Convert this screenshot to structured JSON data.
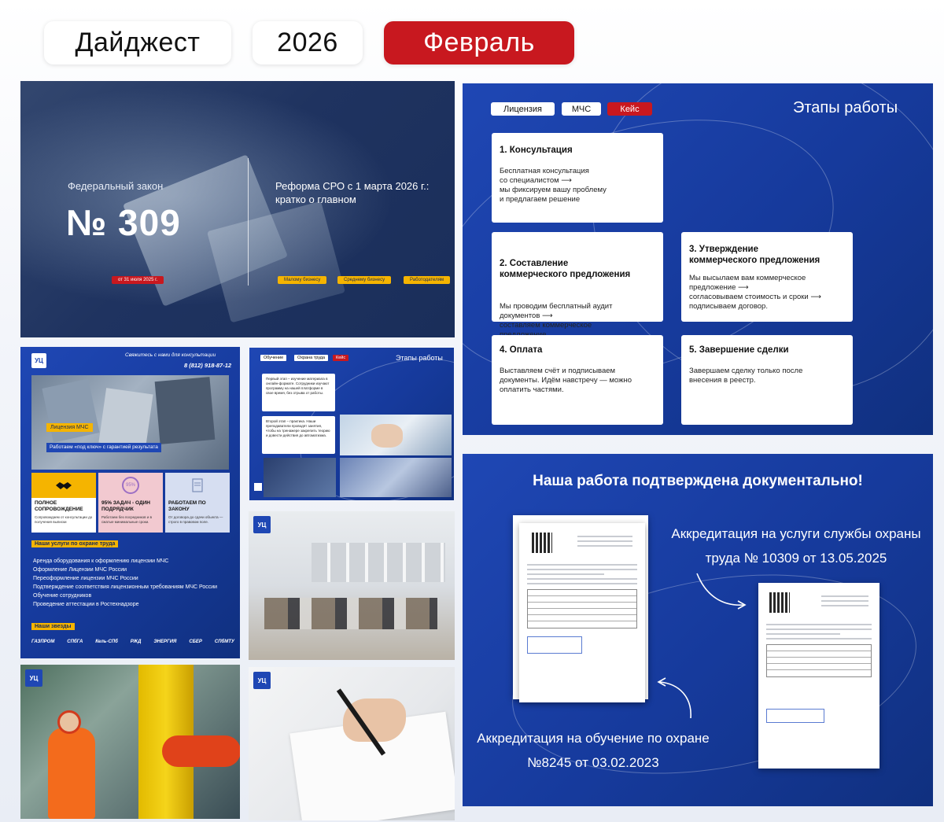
{
  "header": {
    "digest_label": "Дайджест",
    "year_label": "2026",
    "month_label": "Февраль"
  },
  "law_panel": {
    "caption": "Федеральный закон",
    "number": "№ 309",
    "date_tag": "от 31 июля 2025 г.",
    "reform_title": "Реформа СРО с 1 марта 2026 г.: кратко о главном",
    "audience_tags": [
      "Малому бизнесу",
      "Среднему бизнесу",
      "Работодателям"
    ]
  },
  "stages_panel": {
    "tabs": [
      "Лицензия",
      "МЧС",
      "Кейс"
    ],
    "title": "Этапы работы",
    "stages": [
      {
        "title": "1. Консультация",
        "body": "Бесплатная консультация\nсо специалистом ⟶\nмы фиксируем вашу проблему\nи предлагаем решение"
      },
      {
        "title": "2. Составление\nкоммерческого предложения",
        "body": "Мы проводим бесплатный аудит\nдокументов ⟶\nсоставляем коммерческое\nпредложение."
      },
      {
        "title": "3. Утверждение\nкоммерческого предложения",
        "body": "Мы высылаем вам коммерческое\nпредложение ⟶\nсогласовываем стоимость и сроки ⟶\nподписываем договор."
      },
      {
        "title": "4. Оплата",
        "body": "Выставляем счёт и подписываем\nдокументы. Идём навстречу — можно\nоплатить частями."
      },
      {
        "title": "5. Завершение сделки",
        "body": "Завершаем сделку только после\nвнесения в реестр."
      }
    ]
  },
  "contact_panel": {
    "logo": "УЦ",
    "contact_text": "Свяжитесь с нами для консультации",
    "phone": "8 (812) 918-87-12",
    "license_tag": "Лицензия МЧС",
    "license_sub": "Работаем «под ключ» с гарантией результата",
    "features": [
      {
        "title": "ПОЛНОЕ СОПРОВОЖДЕНИЕ",
        "sub": "Сопровождаем от консультации до получения выписки"
      },
      {
        "title": "95% ЗАДАЧ - ОДИН ПОДРЯДЧИК",
        "sub": "Работаем без посредников и в сжатые минимальные сроки."
      },
      {
        "title": "РАБОТАЕМ ПО ЗАКОНУ",
        "sub": "От договора до сдачи объекта — строго в правовом поле."
      }
    ],
    "percent_badge": "95%",
    "services_heading": "Наши услуги по охране труда",
    "services": [
      "Аренда оборудования к оформлению лицензии МЧС",
      "Оформление Лицензии МЧС России",
      "Переоформление лицензии МЧС России",
      "Подтверждение соответствия лицензионным требованиям МЧС России",
      "Обучение сотрудников",
      "Проведение аттестации в Ростехнадзоре"
    ],
    "partners_heading": "Наши звезды",
    "partners": [
      "ГАЗПРОМ",
      "СПбГА",
      "Кель-СПб",
      "РЖД",
      "ЭНЕРГИЯ",
      "СБЕР",
      "СПбМТУ"
    ]
  },
  "small_stages_panel": {
    "tabs": [
      "Обучение",
      "Охрана труда",
      "Кейс"
    ],
    "title": "Этапы работы",
    "card1": "Первый этап – изучение материала в онлайн-формате. Сотрудники изучают программу на нашей платформе в свое время, без отрыва от работы.",
    "card2": "Второй этап – практика. Наши преподаватели проводят занятия, чтобы на тренажере закрепить теорию и довести действия до автоматизма."
  },
  "photo_badges": [
    "УЦ",
    "УЦ",
    "УЦ"
  ],
  "accred_panel": {
    "heading": "Наша работа подтверждена документально!",
    "text_right": "Аккредитация на услуги службы охраны труда № 10309 от 13.05.2025",
    "text_left": "Аккредитация на обучение по охране №8245 от 03.02.2023"
  },
  "colors": {
    "brand_blue": "#1f47b4",
    "accent_red": "#c8181f",
    "accent_yellow": "#f5b400"
  }
}
